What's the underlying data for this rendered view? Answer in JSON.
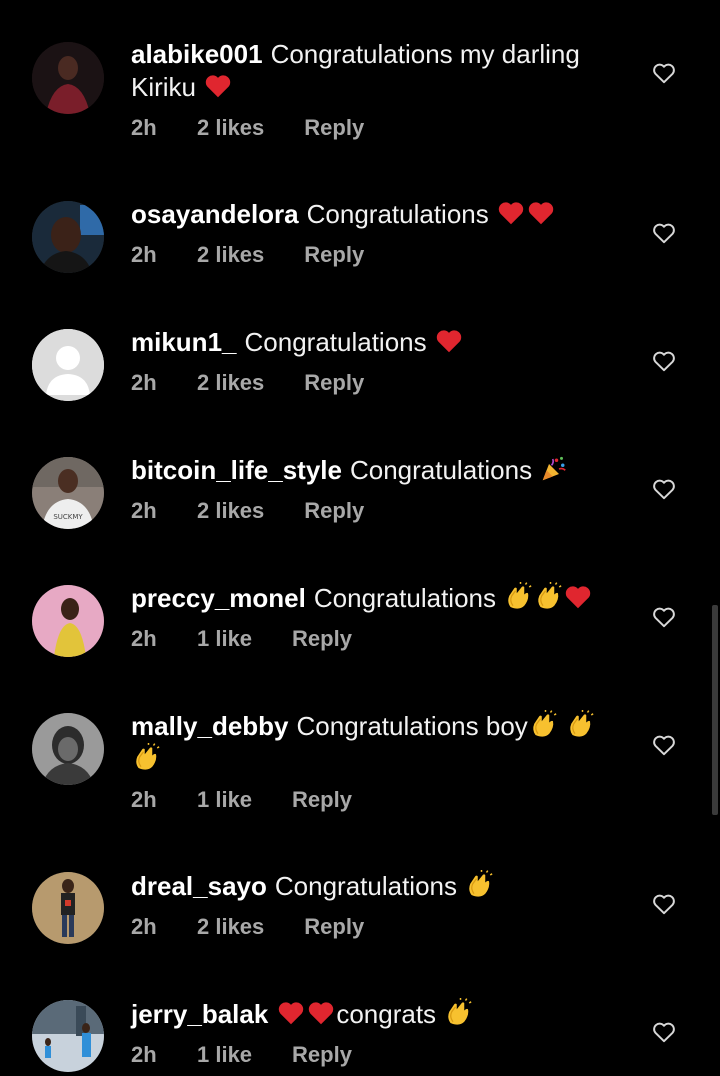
{
  "colors": {
    "background": "#000000",
    "text": "#ffffff",
    "meta": "#a8a8a8",
    "heart_emoji": "#e0262f"
  },
  "comments": [
    {
      "username": "alabike001",
      "text": "Congratulations my darling Kiriku",
      "emojis": [
        "red-heart"
      ],
      "time": "2h",
      "likes": "2 likes",
      "reply": "Reply"
    },
    {
      "username": "osayandelora",
      "text": "Congratulations",
      "emojis": [
        "red-heart",
        "red-heart"
      ],
      "time": "2h",
      "likes": "2 likes",
      "reply": "Reply"
    },
    {
      "username": "mikun1_",
      "text": "Congratulations",
      "emojis": [
        "red-heart"
      ],
      "time": "2h",
      "likes": "2 likes",
      "reply": "Reply"
    },
    {
      "username": "bitcoin_life_style",
      "text": "Congratulations",
      "emojis": [
        "party-popper"
      ],
      "time": "2h",
      "likes": "2 likes",
      "reply": "Reply"
    },
    {
      "username": "preccy_monel",
      "text": "Congratulations",
      "emojis": [
        "clapping-hands",
        "clapping-hands",
        "red-heart"
      ],
      "time": "2h",
      "likes": "1 like",
      "reply": "Reply"
    },
    {
      "username": "mally_debby",
      "text": "Congratulations boy",
      "emojis": [
        "clapping-hands",
        "clapping-hands",
        "clapping-hands"
      ],
      "time": "2h",
      "likes": "1 like",
      "reply": "Reply"
    },
    {
      "username": "dreal_sayo",
      "text": "Congratulations",
      "emojis": [
        "clapping-hands"
      ],
      "time": "2h",
      "likes": "2 likes",
      "reply": "Reply"
    },
    {
      "username": "jerry_balak",
      "text": "congrats",
      "emojis_before": [
        "red-heart",
        "red-heart"
      ],
      "emojis": [
        "clapping-hands"
      ],
      "time": "2h",
      "likes": "1 like",
      "reply": "Reply"
    }
  ]
}
